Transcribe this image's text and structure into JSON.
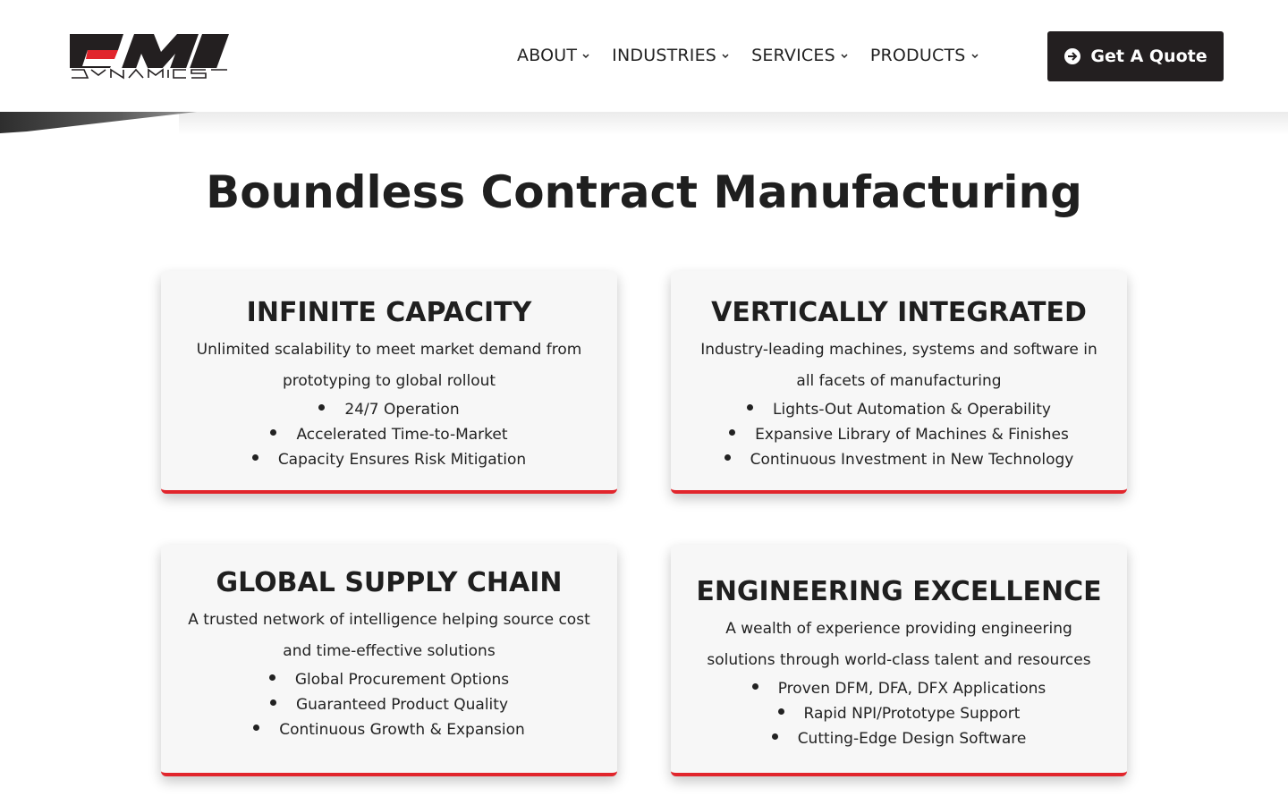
{
  "brand": {
    "name": "DMI Dynamics",
    "accent_red": "#e1252c",
    "dark": "#231f20"
  },
  "header": {
    "nav": [
      {
        "label": "ABOUT"
      },
      {
        "label": "INDUSTRIES"
      },
      {
        "label": "SERVICES"
      },
      {
        "label": "PRODUCTS"
      }
    ],
    "cta_label": "Get A Quote"
  },
  "main": {
    "title": "Boundless Contract Manufacturing",
    "cards": [
      {
        "heading": "INFINITE CAPACITY",
        "description": "Unlimited scalability to meet market demand from prototyping to global rollout",
        "bullets": [
          "24/7 Operation",
          "Accelerated Time-to-Market",
          "Capacity Ensures Risk Mitigation"
        ]
      },
      {
        "heading": "VERTICALLY INTEGRATED",
        "description": "Industry-leading machines, systems and software in all facets of manufacturing",
        "bullets": [
          "Lights-Out Automation & Operability",
          "Expansive Library of Machines & Finishes",
          "Continuous Investment in New Technology"
        ]
      },
      {
        "heading": "GLOBAL SUPPLY CHAIN",
        "description": "A trusted network of intelligence helping source cost and time-effective solutions",
        "bullets": [
          "Global Procurement Options",
          "Guaranteed Product Quality",
          "Continuous Growth & Expansion"
        ]
      },
      {
        "heading": "ENGINEERING EXCELLENCE",
        "description": "A wealth of experience providing engineering solutions through world-class talent and resources",
        "bullets": [
          "Proven DFM, DFA, DFX Applications",
          "Rapid NPI/Prototype Support",
          "Cutting-Edge Design Software"
        ]
      }
    ]
  }
}
